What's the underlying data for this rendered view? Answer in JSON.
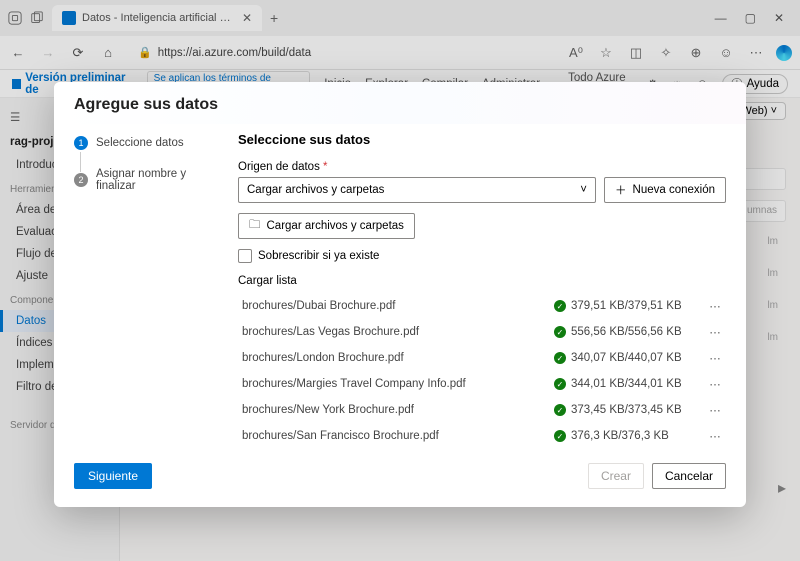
{
  "browser": {
    "tab_title": "Datos - Inteligencia artificial de Azure Studio",
    "url": "https://ai.azure.com/build/data"
  },
  "app_header": {
    "brand": "Versión preliminar de",
    "chip": "Se aplican los términos de versi…",
    "nav": [
      "Inicio",
      "Explorar",
      "Compilar",
      "Administrar"
    ],
    "right_label": "Todo Azure AI",
    "help": "Ayuda"
  },
  "sidebar": {
    "project": "rag-project",
    "items_top": [
      "Introducción"
    ],
    "tools_label": "Herramientas",
    "tools": [
      "Área de juegos",
      "Evaluación",
      "Flujo de aviso",
      "Ajuste"
    ],
    "components_label": "Componentes",
    "components": [
      "Datos",
      "Índices",
      "Implementaciones",
      "Filtro de contenido"
    ],
    "server_label": "Servidor de p",
    "active_index": 0
  },
  "page_bg": {
    "pill": "(Web)",
    "col_label": "umnas",
    "row_suffix": "lm"
  },
  "modal": {
    "title": "Agregue sus datos",
    "steps": [
      {
        "label": "Seleccione datos",
        "active": true
      },
      {
        "label": "Asignar nombre y finalizar",
        "active": false
      }
    ],
    "panel_title": "Seleccione sus datos",
    "datasource_label": "Origen de datos",
    "datasource_value": "Cargar archivos y carpetas",
    "new_connection": "Nueva conexión",
    "upload_button": "Cargar archivos y carpetas",
    "overwrite_label": "Sobrescribir si ya existe",
    "list_header": "Cargar lista",
    "uploads": [
      {
        "name": "brochures/Dubai Brochure.pdf",
        "status": "379,51 KB/379,51 KB"
      },
      {
        "name": "brochures/Las Vegas Brochure.pdf",
        "status": "556,56 KB/556,56 KB"
      },
      {
        "name": "brochures/London Brochure.pdf",
        "status": "340,07 KB/440,07 KB"
      },
      {
        "name": "brochures/Margies Travel Company Info.pdf",
        "status": "344,01 KB/344,01 KB"
      },
      {
        "name": "brochures/New York Brochure.pdf",
        "status": "373,45 KB/373,45 KB"
      },
      {
        "name": "brochures/San Francisco Brochure.pdf",
        "status": "376,3 KB/376,3 KB"
      }
    ],
    "next": "Siguiente",
    "create": "Crear",
    "cancel": "Cancelar"
  }
}
